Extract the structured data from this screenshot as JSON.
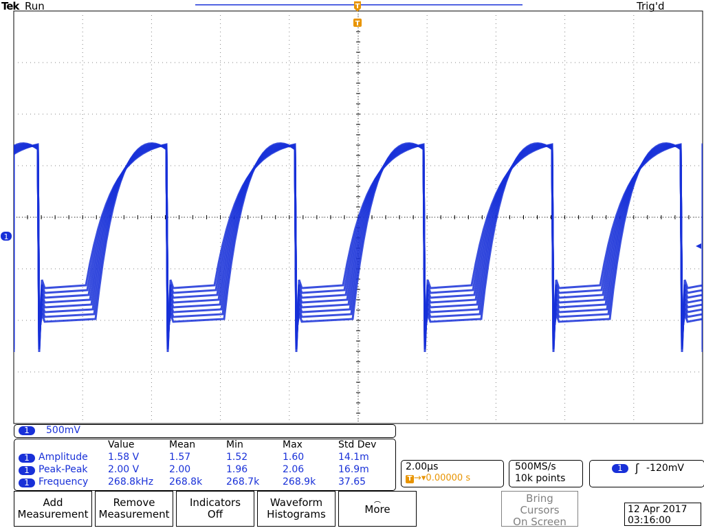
{
  "header": {
    "brand": "Tek",
    "run_state": "Run",
    "trigger_state": "Trig'd"
  },
  "markers": {
    "trigger_position": "T",
    "channel_ground": "1"
  },
  "channel": {
    "number": "1",
    "vertical_scale": "500mV",
    "color": "#1830d8"
  },
  "measurements": {
    "headers": [
      "Value",
      "Mean",
      "Min",
      "Max",
      "Std Dev"
    ],
    "rows": [
      {
        "channel": "1",
        "name": "Amplitude",
        "value": "1.58 V",
        "mean": "1.57",
        "min": "1.52",
        "max": "1.60",
        "std_dev": "14.1m"
      },
      {
        "channel": "1",
        "name": "Peak-Peak",
        "value": "2.00 V",
        "mean": "2.00",
        "min": "1.96",
        "max": "2.06",
        "std_dev": "16.9m"
      },
      {
        "channel": "1",
        "name": "Frequency",
        "value": "268.8kHz",
        "mean": "268.8k",
        "min": "268.7k",
        "max": "268.9k",
        "std_dev": "37.65"
      }
    ]
  },
  "horizontal": {
    "time_per_div": "2.00µs",
    "trigger_marker": "T",
    "position": "0.00000 s",
    "position_color": "#e89400"
  },
  "acquisition": {
    "sample_rate": "500MS/s",
    "record_length": "10k points"
  },
  "trigger": {
    "channel": "1",
    "slope_icon": "rising-edge-icon",
    "level": "-120mV"
  },
  "buttons": {
    "add_measurement": [
      "Add",
      "Measurement"
    ],
    "remove_measurement": [
      "Remove",
      "Measurement"
    ],
    "indicators": [
      "Indicators",
      "Off"
    ],
    "waveform_histograms": [
      "Waveform",
      "Histograms"
    ],
    "more": "More",
    "bring_cursors": [
      "Bring",
      "Cursors",
      "On Screen"
    ]
  },
  "datetime": {
    "date": "12 Apr  2017",
    "time": "03:16:00"
  }
}
